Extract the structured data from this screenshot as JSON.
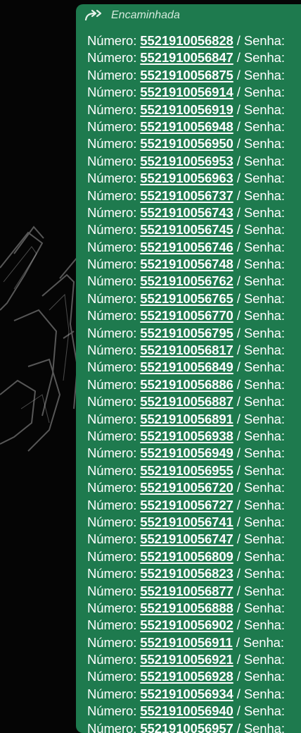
{
  "message": {
    "forwarded_label": "Encaminhada",
    "forward_icon": "double-forward-arrow-icon",
    "number_prefix": "Número: ",
    "password_suffix": " / Senha:",
    "numbers": [
      "5521910056828",
      "5521910056847",
      "5521910056875",
      "5521910056914",
      "5521910056919",
      "5521910056948",
      "5521910056950",
      "5521910056953",
      "5521910056963",
      "5521910056737",
      "5521910056743",
      "5521910056745",
      "5521910056746",
      "5521910056748",
      "5521910056762",
      "5521910056765",
      "5521910056770",
      "5521910056795",
      "5521910056817",
      "5521910056849",
      "5521910056886",
      "5521910056887",
      "5521910056891",
      "5521910056938",
      "5521910056949",
      "5521910056955",
      "5521910056720",
      "5521910056727",
      "5521910056741",
      "5521910056747",
      "5521910056809",
      "5521910056823",
      "5521910056877",
      "5521910056888",
      "5521910056902",
      "5521910056911",
      "5521910056921",
      "5521910056928",
      "5521910056934",
      "5521910056940",
      "5521910056957"
    ]
  },
  "colors": {
    "bubble": "#1e7a4e",
    "background": "#000000",
    "text": "#ffffff",
    "forwarded_text": "#d4eadc"
  }
}
